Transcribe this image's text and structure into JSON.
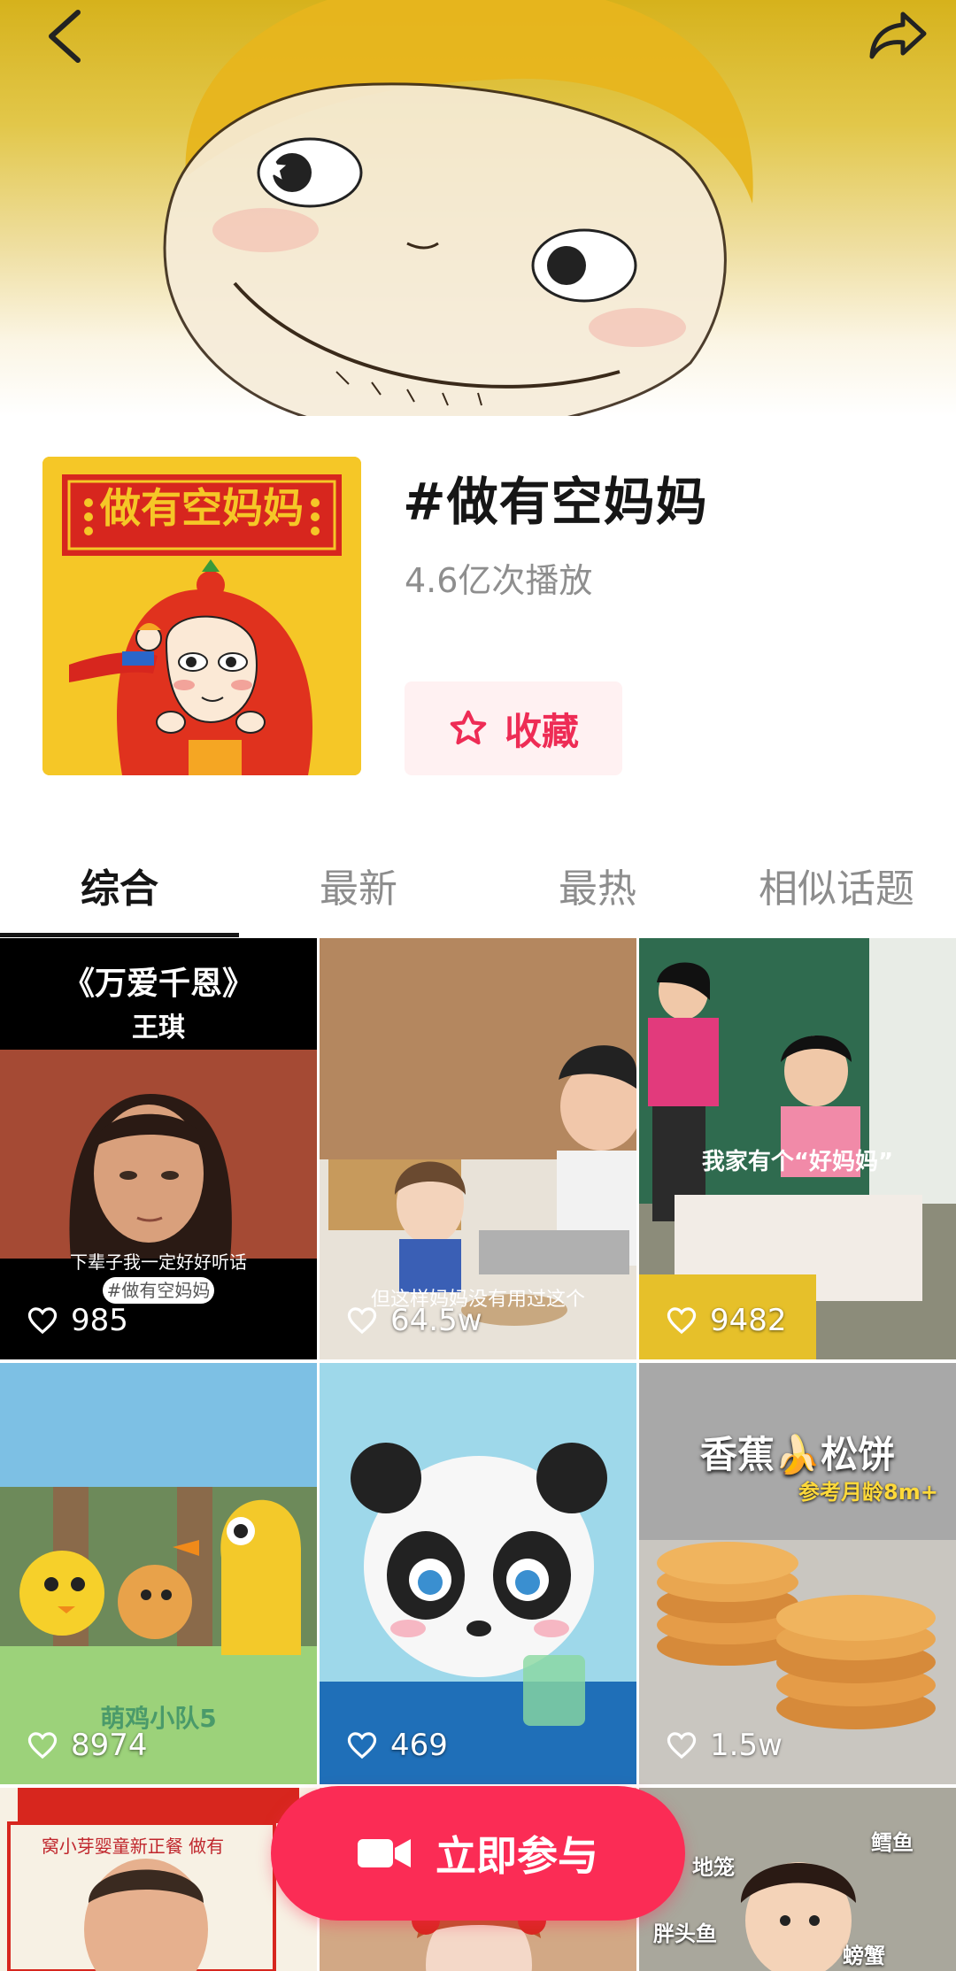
{
  "header": {
    "back_icon": "chevron-left-icon",
    "share_icon": "share-arrow-icon"
  },
  "topic": {
    "title": "#做有空妈妈",
    "plays": "4.6亿次播放",
    "cover_banner_text": "做有空妈妈",
    "favorite_label": "收藏",
    "favorite_icon": "star-outline-icon"
  },
  "tabs": [
    {
      "label": "综合",
      "active": true
    },
    {
      "label": "最新",
      "active": false
    },
    {
      "label": "最热",
      "active": false
    },
    {
      "label": "相似话题",
      "active": false
    }
  ],
  "videos": [
    {
      "likes": "985",
      "title_line1": "《万爱千恩》",
      "title_line2": "王琪",
      "subtitle": "下辈子我一定好好听话",
      "tag": "#做有空妈妈"
    },
    {
      "likes": "64.5w",
      "subtitle": "但这样妈妈没有用过这个"
    },
    {
      "likes": "9482",
      "subtitle": "我家有个“好妈妈”"
    },
    {
      "likes": "8974",
      "subtitle": "萌鸡小队5"
    },
    {
      "likes": "469"
    },
    {
      "likes": "1.5w",
      "title": "香蕉🍌松饼",
      "subtitle": "参考月龄8m+"
    },
    {
      "subtitle": "窝小芽婴童新正餐 做有"
    },
    {},
    {
      "label1": "地笼",
      "label2": "鳕鱼",
      "label3": "胖头鱼",
      "label4": "螃蟹"
    }
  ],
  "join": {
    "label": "立即参与",
    "icon": "video-camera-icon"
  },
  "colors": {
    "accent": "#fb2c55",
    "favorite_bg": "#fff1f2",
    "banner_yellow": "#d6b21c"
  }
}
